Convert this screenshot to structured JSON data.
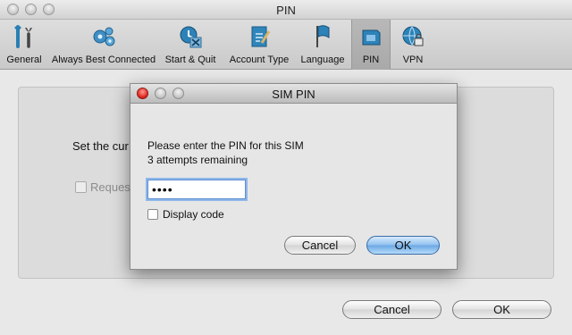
{
  "window": {
    "title": "PIN"
  },
  "toolbar": {
    "items": [
      {
        "label": "General",
        "icon": "general-tools-icon"
      },
      {
        "label": "Always Best Connected",
        "icon": "gears-icon"
      },
      {
        "label": "Start & Quit",
        "icon": "start-quit-icon"
      },
      {
        "label": "Account Type",
        "icon": "account-type-icon"
      },
      {
        "label": "Language",
        "icon": "flag-icon"
      },
      {
        "label": "PIN",
        "icon": "sim-card-icon",
        "selected": true
      },
      {
        "label": "VPN",
        "icon": "globe-lock-icon"
      }
    ]
  },
  "background": {
    "set_current_label": "Set the cur",
    "request_label": "Request"
  },
  "dialog": {
    "title": "SIM PIN",
    "prompt": "Please enter the PIN for this SIM",
    "attempts": "3 attempts remaining",
    "pin_value": "••••",
    "display_code_label": "Display code",
    "cancel_label": "Cancel",
    "ok_label": "OK"
  },
  "footer": {
    "cancel_label": "Cancel",
    "ok_label": "OK"
  },
  "colors": {
    "accent": "#6aa7e3",
    "close_button": "#e2261d"
  }
}
